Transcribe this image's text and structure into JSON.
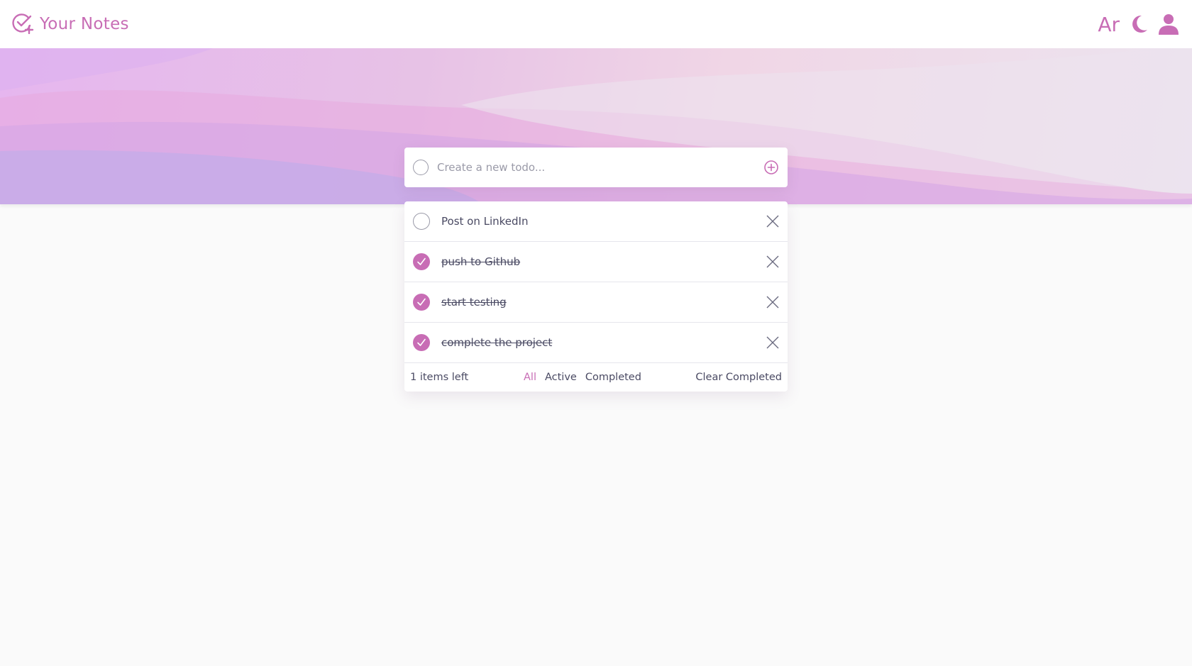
{
  "app": {
    "title": "Your Notes",
    "logo_icon": "check-circle-plus-icon"
  },
  "nav": {
    "lang_label": "Ar",
    "theme_icon": "moon-icon",
    "profile_icon": "user-icon"
  },
  "new_todo": {
    "placeholder": "Create a new todo...",
    "add_icon": "plus-circle-icon"
  },
  "todos": [
    {
      "text": "Post on LinkedIn",
      "completed": false
    },
    {
      "text": "push to Github",
      "completed": true
    },
    {
      "text": "start testing",
      "completed": true
    },
    {
      "text": "complete the project",
      "completed": true
    }
  ],
  "footer": {
    "items_left": "1 items left",
    "filters": {
      "all": "All",
      "active": "Active",
      "completed": "Completed"
    },
    "active_filter": "All",
    "clear_label": "Clear Completed"
  },
  "colors": {
    "accent": "#c86db5",
    "text": "#4a4a63",
    "background": "#fafafa"
  }
}
